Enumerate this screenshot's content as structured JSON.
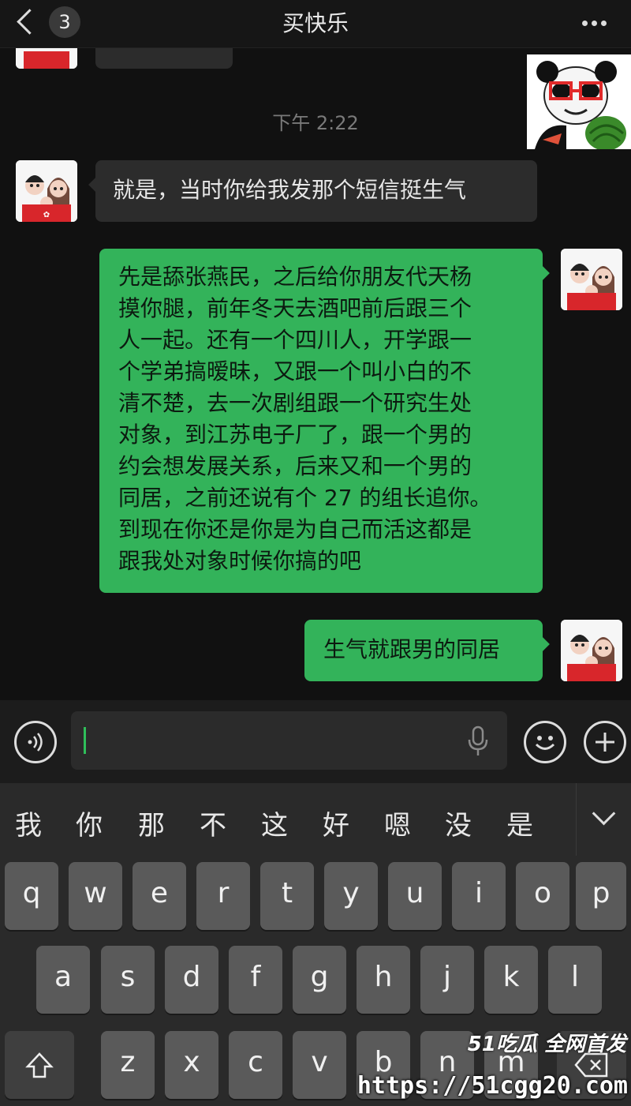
{
  "header": {
    "unread_count": "3",
    "title": "买快乐"
  },
  "chat": {
    "timestamp": "下午 2:22",
    "messages": [
      {
        "sender": "them",
        "text": "就是，当时你给我发那个短信挺生气"
      },
      {
        "sender": "me",
        "text": "先是舔张燕民，之后给你朋友代天杨\n摸你腿，前年冬天去酒吧前后跟三个\n人一起。还有一个四川人，开学跟一\n个学弟搞暧昧，又跟一个叫小白的不\n清不楚，去一次剧组跟一个研究生处\n对象，到江苏电子厂了，跟一个男的\n约会想发展关系，后来又和一个男的\n同居，之前还说有个 27 的组长追你。\n到现在你还是你是为自己而活这都是\n跟我处对象时候你搞的吧"
      },
      {
        "sender": "me",
        "text": "生气就跟男的同居"
      }
    ],
    "sticker": "panda-meme-sticker"
  },
  "input_bar": {
    "voice_icon": "voice-icon",
    "mic_icon": "mic-icon",
    "emoji_icon": "emoji-icon",
    "plus_icon": "plus-icon"
  },
  "keyboard": {
    "candidates": [
      "我",
      "你",
      "那",
      "不",
      "这",
      "好",
      "嗯",
      "没",
      "是"
    ],
    "row1": [
      "q",
      "w",
      "e",
      "r",
      "t",
      "y",
      "u",
      "i",
      "o",
      "p"
    ],
    "row2": [
      "a",
      "s",
      "d",
      "f",
      "g",
      "h",
      "j",
      "k",
      "l"
    ],
    "row3": [
      "z",
      "x",
      "c",
      "v",
      "b",
      "n",
      "m"
    ]
  },
  "watermark": {
    "logo": "51吃瓜 全网首发",
    "url": "https://51cgg20.com"
  },
  "colors": {
    "bubble_out": "#33b35a",
    "bubble_in": "#2c2c2c",
    "background": "#111111"
  }
}
